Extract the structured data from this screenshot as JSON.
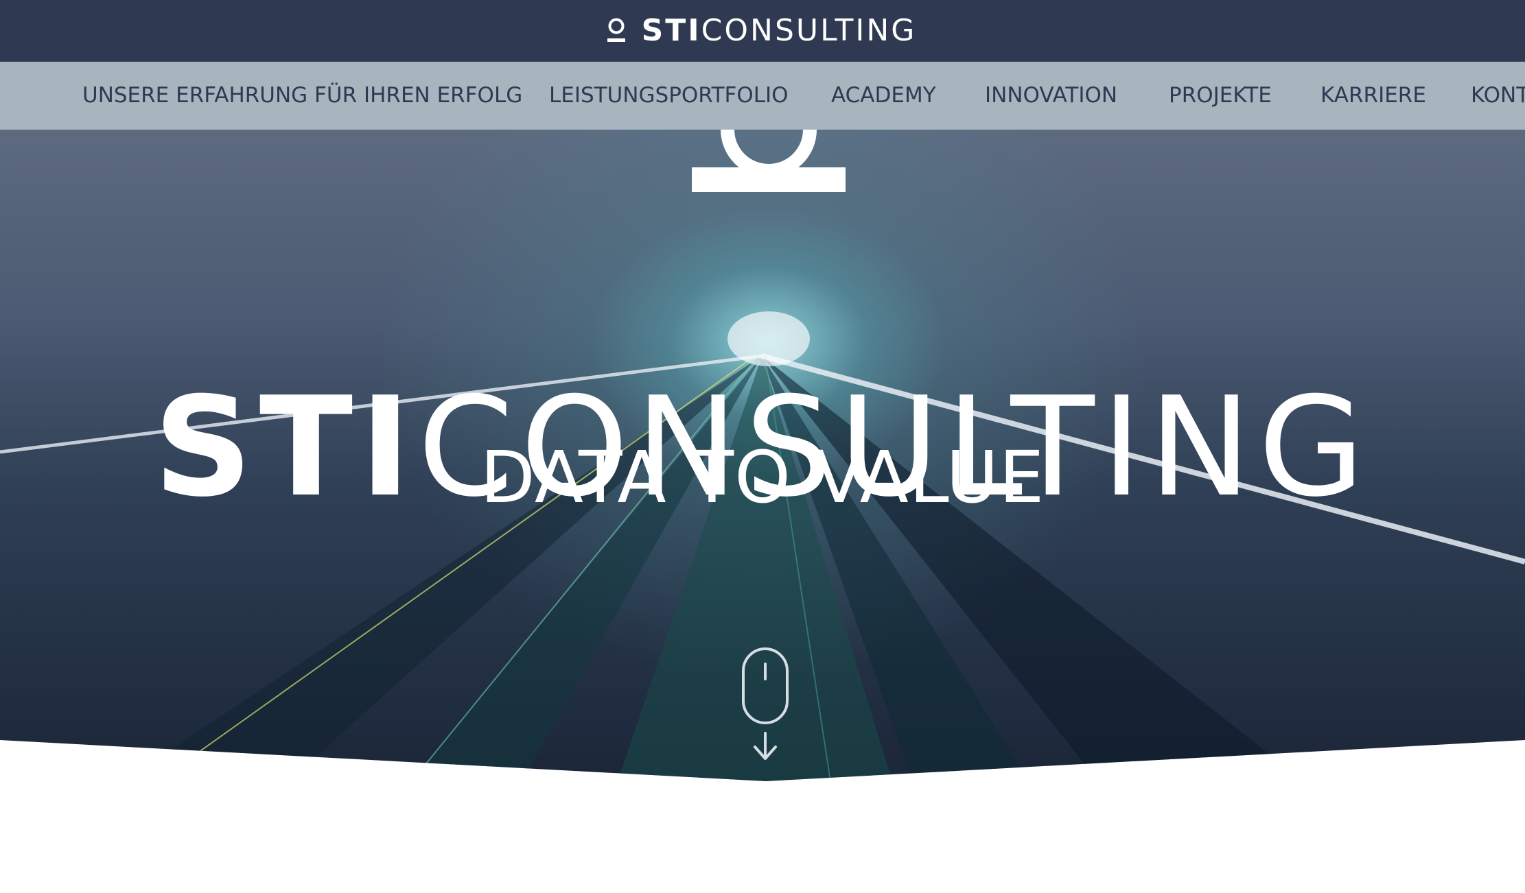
{
  "header": {
    "logo_icon": "person-icon",
    "brand_bold": "STI",
    "brand_light": "CONSULTING"
  },
  "nav": {
    "items": [
      "UNSERE ERFAHRUNG FÜR IHREN ERFOLG",
      "LEISTUNGSPORTFOLIO",
      "ACADEMY",
      "INNOVATION",
      "PROJEKTE",
      "KARRIERE",
      "KONT"
    ]
  },
  "hero": {
    "title_bold": "STI",
    "title_light": "CONSULTING",
    "tagline": "DATA TO VALUE",
    "scroll_icon": "mouse-scroll-icon"
  },
  "colors": {
    "topbar": "#2f3a52",
    "navbar": "#a8b5bf",
    "nav_text": "#2f3a52",
    "hero_text": "#ffffff"
  }
}
